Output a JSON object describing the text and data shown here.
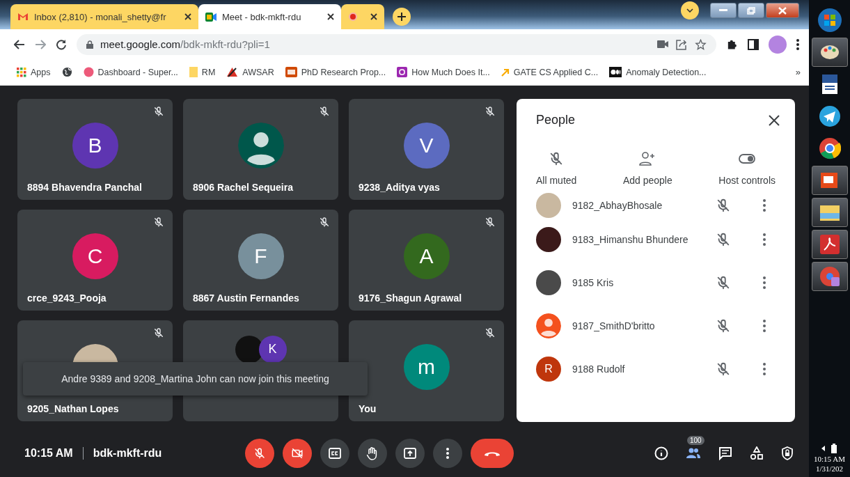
{
  "browser": {
    "tabs": [
      {
        "title": "Inbox (2,810) - monali_shetty@fr",
        "selected": false
      },
      {
        "title": "Meet - bdk-mkft-rdu",
        "selected": true
      },
      {
        "selected": false
      }
    ],
    "url": {
      "domain": "meet.google.com",
      "path": "/bdk-mkft-rdu?pli=1"
    },
    "bookmarks": [
      {
        "label": "Apps"
      },
      {
        "label": "Dashboard - Super..."
      },
      {
        "label": "RM"
      },
      {
        "label": "AWSAR"
      },
      {
        "label": "PhD Research Prop..."
      },
      {
        "label": "How Much Does It..."
      },
      {
        "label": "GATE CS Applied C..."
      },
      {
        "label": "Anomaly Detection..."
      }
    ],
    "bookmarks_more": "»"
  },
  "tiles": [
    {
      "name": "8894 Bhavendra Panchal",
      "kind": "letter",
      "initial": "B",
      "color": "#5e35b1",
      "muted": true
    },
    {
      "name": "8906 Rachel Sequeira",
      "kind": "silhouette",
      "color": "#00574b",
      "muted": true
    },
    {
      "name": "9238_Aditya vyas",
      "kind": "letter",
      "initial": "V",
      "color": "#5c6bc0",
      "muted": true
    },
    {
      "name": "crce_9243_Pooja",
      "kind": "letter",
      "initial": "C",
      "color": "#d81b60",
      "muted": true
    },
    {
      "name": "8867 Austin Fernandes",
      "kind": "letter",
      "initial": "F",
      "color": "#78909c",
      "muted": true
    },
    {
      "name": "9176_Shagun Agrawal",
      "kind": "letter",
      "initial": "A",
      "color": "#33691e",
      "muted": true
    },
    {
      "name": "9205_Nathan Lopes",
      "kind": "photo",
      "muted": true
    },
    {
      "kind": "pair",
      "initial": "K",
      "color": "#5e35b1",
      "muted": false
    },
    {
      "name": "You",
      "kind": "letter",
      "initial": "m",
      "color": "#00897b",
      "muted": true
    }
  ],
  "toast": "Andre 9389 and 9208_Martina John can now join this meeting",
  "people_panel": {
    "title": "People",
    "actions": [
      {
        "label": "All muted"
      },
      {
        "label": "Add people"
      },
      {
        "label": "Host controls"
      }
    ],
    "participants": [
      {
        "name": "9182_AbhayBhosale",
        "kind": "photo",
        "muted": true
      },
      {
        "name": "9183_Himanshu Bhundere",
        "kind": "photo",
        "muted": true
      },
      {
        "name": "9185 Kris",
        "kind": "photo",
        "muted": true
      },
      {
        "name": "9187_SmithD'britto",
        "kind": "silhouette",
        "color": "#f4511e",
        "muted": true
      },
      {
        "name": "9188 Rudolf",
        "kind": "letter",
        "initial": "R",
        "color": "#bf360c",
        "muted": true
      }
    ]
  },
  "bottom_bar": {
    "time": "10:15 AM",
    "meeting_code": "bdk-mkft-rdu",
    "mic_on": false,
    "camera_on": false,
    "people_count": "100"
  },
  "taskbar": {
    "time": "10:15 AM",
    "date": "1/31/202"
  }
}
